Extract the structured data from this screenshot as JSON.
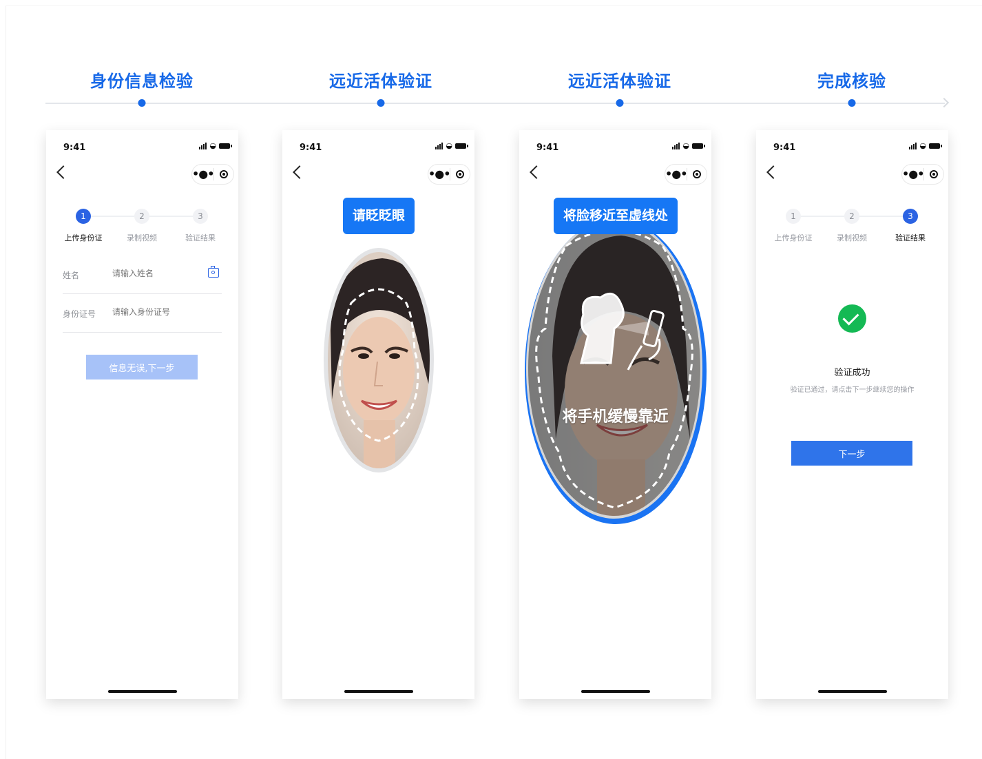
{
  "timeline": {
    "steps": [
      {
        "label": "身份信息检验"
      },
      {
        "label": "远近活体验证"
      },
      {
        "label": "远近活体验证"
      },
      {
        "label": "完成核验"
      }
    ]
  },
  "status_bar": {
    "time": "9:41"
  },
  "screen1": {
    "stepper": [
      {
        "number": "1",
        "label": "上传身份证",
        "state": "active"
      },
      {
        "number": "2",
        "label": "录制视频",
        "state": "inactive"
      },
      {
        "number": "3",
        "label": "验证结果",
        "state": "inactive"
      }
    ],
    "name_field": {
      "label": "姓名",
      "placeholder": "请输入姓名"
    },
    "id_field": {
      "label": "身份证号",
      "placeholder": "请输入身份证号"
    },
    "submit_label": "信息无误,下一步"
  },
  "screen2": {
    "tip": "请眨眨眼"
  },
  "screen3": {
    "tip": "将脸移近至虚线处",
    "overlay": "将手机缓慢靠近"
  },
  "screen4": {
    "stepper": [
      {
        "number": "1",
        "label": "上传身份证",
        "state": "inactive"
      },
      {
        "number": "2",
        "label": "录制视频",
        "state": "inactive"
      },
      {
        "number": "3",
        "label": "验证结果",
        "state": "active"
      }
    ],
    "result_title": "验证成功",
    "result_desc": "验证已通过，请点击下一步继续您的操作",
    "next_label": "下一步"
  },
  "colors": {
    "accent": "#1769e8",
    "success": "#14b954",
    "button": "#2f74ea",
    "button_disabled": "#a7c2f8"
  },
  "icons": [
    "back-icon",
    "more-icon",
    "target-icon",
    "camera-icon",
    "check-icon",
    "phone-scan-icon"
  ]
}
